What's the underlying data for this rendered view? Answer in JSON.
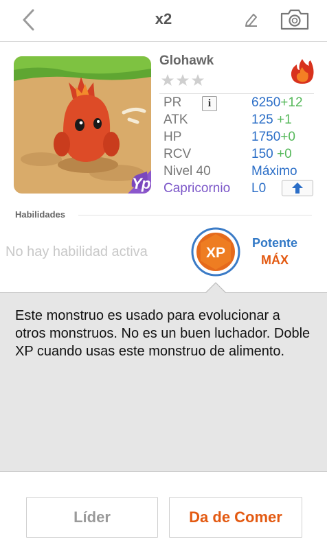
{
  "header": {
    "title": "x2",
    "icons": [
      "back-arrow-icon",
      "pencil-icon",
      "camera-icon"
    ]
  },
  "monster": {
    "name": "Glohawk",
    "stars_filled": 0,
    "stars_total": 3,
    "element_icon": "fire-icon",
    "badge_icon": "xp-badge-icon"
  },
  "stats": {
    "pr_label": "PR",
    "pr_value": "6250",
    "pr_bonus": "+12",
    "atk_label": "ATK",
    "atk_value": "125",
    "atk_bonus": "+1",
    "hp_label": "HP",
    "hp_value": "1750",
    "hp_bonus": "+0",
    "rcv_label": "RCV",
    "rcv_value": "150",
    "rcv_bonus": "+0",
    "level_label": "Nivel 40",
    "level_value": "Máximo",
    "sign_label": "Capricornio",
    "sign_value": "L0"
  },
  "skills": {
    "label": "Habilidades",
    "empty_text": "No hay habilidad activa",
    "xp_text": "XP",
    "potente": "Potente",
    "max": "MÁX"
  },
  "description": "Este monstruo es usado para evolucionar a otros monstruos. No es un buen luchador. Doble XP cuando usas este monstruo de alimento.",
  "buttons": {
    "leader": "Líder",
    "feed": "Da de Comer"
  },
  "colors": {
    "blue": "#2b6ec7",
    "green": "#55b85a",
    "purple": "#7b56c8",
    "orange": "#e35a12"
  }
}
